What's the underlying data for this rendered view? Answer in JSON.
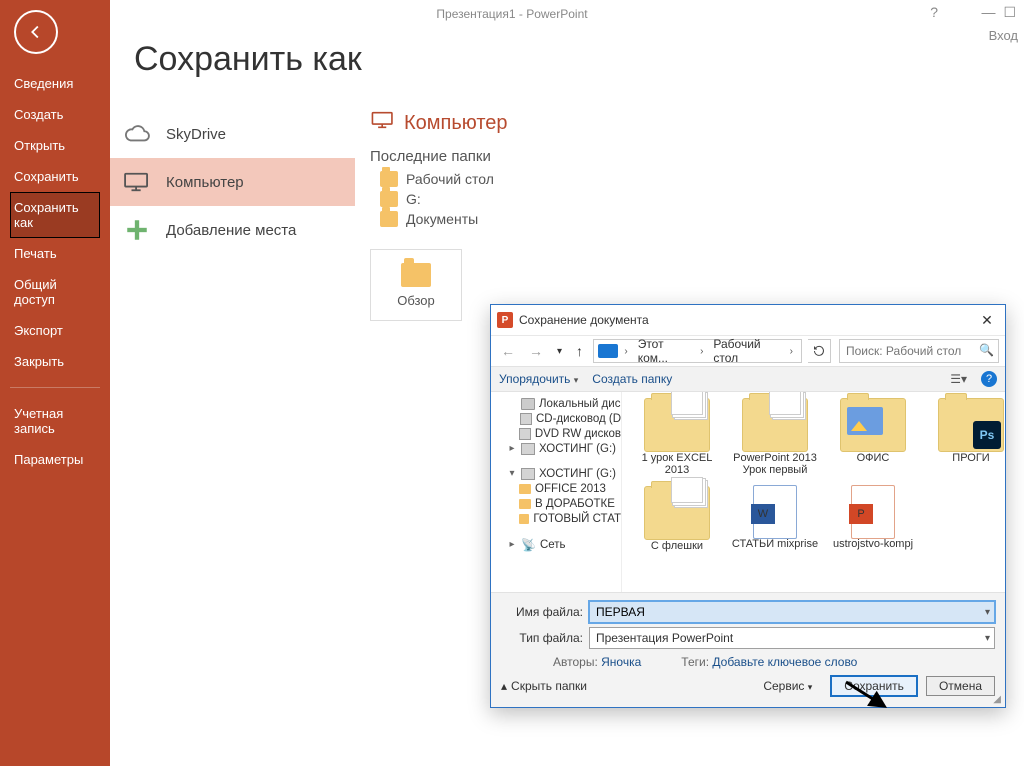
{
  "titlebar": {
    "title": "Презентация1 - PowerPoint",
    "login": "Вход"
  },
  "sidebar": {
    "items": [
      "Сведения",
      "Создать",
      "Открыть",
      "Сохранить",
      "Сохранить как",
      "Печать",
      "Общий доступ",
      "Экспорт",
      "Закрыть"
    ],
    "account": "Учетная\nзапись",
    "params": "Параметры",
    "active_index": 4
  },
  "page": {
    "heading": "Сохранить как",
    "places": {
      "skydrive": "SkyDrive",
      "computer": "Компьютер",
      "add": "Добавление места"
    },
    "right_heading": "Компьютер",
    "recent_label": "Последние папки",
    "recent": [
      "Рабочий стол",
      "G:",
      "Документы"
    ],
    "browse": "Обзор"
  },
  "dialog": {
    "title": "Сохранение документа",
    "breadcrumb": [
      "Этот ком...",
      "Рабочий стол"
    ],
    "search_placeholder": "Поиск: Рабочий стол",
    "toolbar": {
      "organize": "Упорядочить",
      "newfolder": "Создать папку"
    },
    "tree": {
      "local_disk": "Локальный дис",
      "cd": "CD-дисковод (D",
      "dvd": "DVD RW дисков",
      "host1": "ХОСТИНГ (G:)",
      "host2": "ХОСТИНГ (G:)",
      "sub1": "OFFICE 2013",
      "sub2": "В ДОРАБОТКЕ",
      "sub3": "ГОТОВЫЙ СТАТ",
      "net": "Сеть"
    },
    "files": [
      {
        "name": "1 урок EXCEL 2013",
        "kind": "folder-papers"
      },
      {
        "name": "PowerPoint 2013 Урок первый",
        "kind": "folder-papers"
      },
      {
        "name": "ОФИС",
        "kind": "folder-img"
      },
      {
        "name": "ПРОГИ",
        "kind": "folder-ps"
      },
      {
        "name": "С флешки",
        "kind": "folder-papers"
      },
      {
        "name": "СТАТЬИ mixprise",
        "kind": "folder-word"
      },
      {
        "name": "ustrojstvo-kompj",
        "kind": "ppt"
      }
    ],
    "fields": {
      "filename_label": "Имя файла:",
      "filename_value": "ПЕРВАЯ",
      "type_label": "Тип файла:",
      "type_value": "Презентация PowerPoint",
      "authors_label": "Авторы:",
      "authors_value": "Яночка",
      "tags_label": "Теги:",
      "tags_value": "Добавьте ключевое слово"
    },
    "buttons": {
      "hide": "Скрыть папки",
      "service": "Сервис",
      "save": "Сохранить",
      "cancel": "Отмена"
    }
  }
}
